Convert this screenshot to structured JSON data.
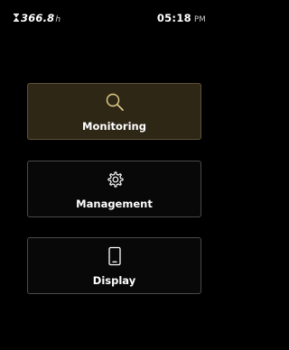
{
  "status_bar": {
    "runtime_value": "366.8",
    "runtime_unit": "h",
    "time": "05:18",
    "ampm": "PM"
  },
  "menu": {
    "items": [
      {
        "label": "Monitoring",
        "icon": "search-icon",
        "selected": true
      },
      {
        "label": "Management",
        "icon": "gear-icon",
        "selected": false
      },
      {
        "label": "Display",
        "icon": "tablet-icon",
        "selected": false
      }
    ]
  },
  "colors": {
    "background": "#000000",
    "selected_tile": "#2e2716",
    "tile_border": "#4a4a4a",
    "accent_icon": "#e6cf8a",
    "text": "#ffffff"
  }
}
